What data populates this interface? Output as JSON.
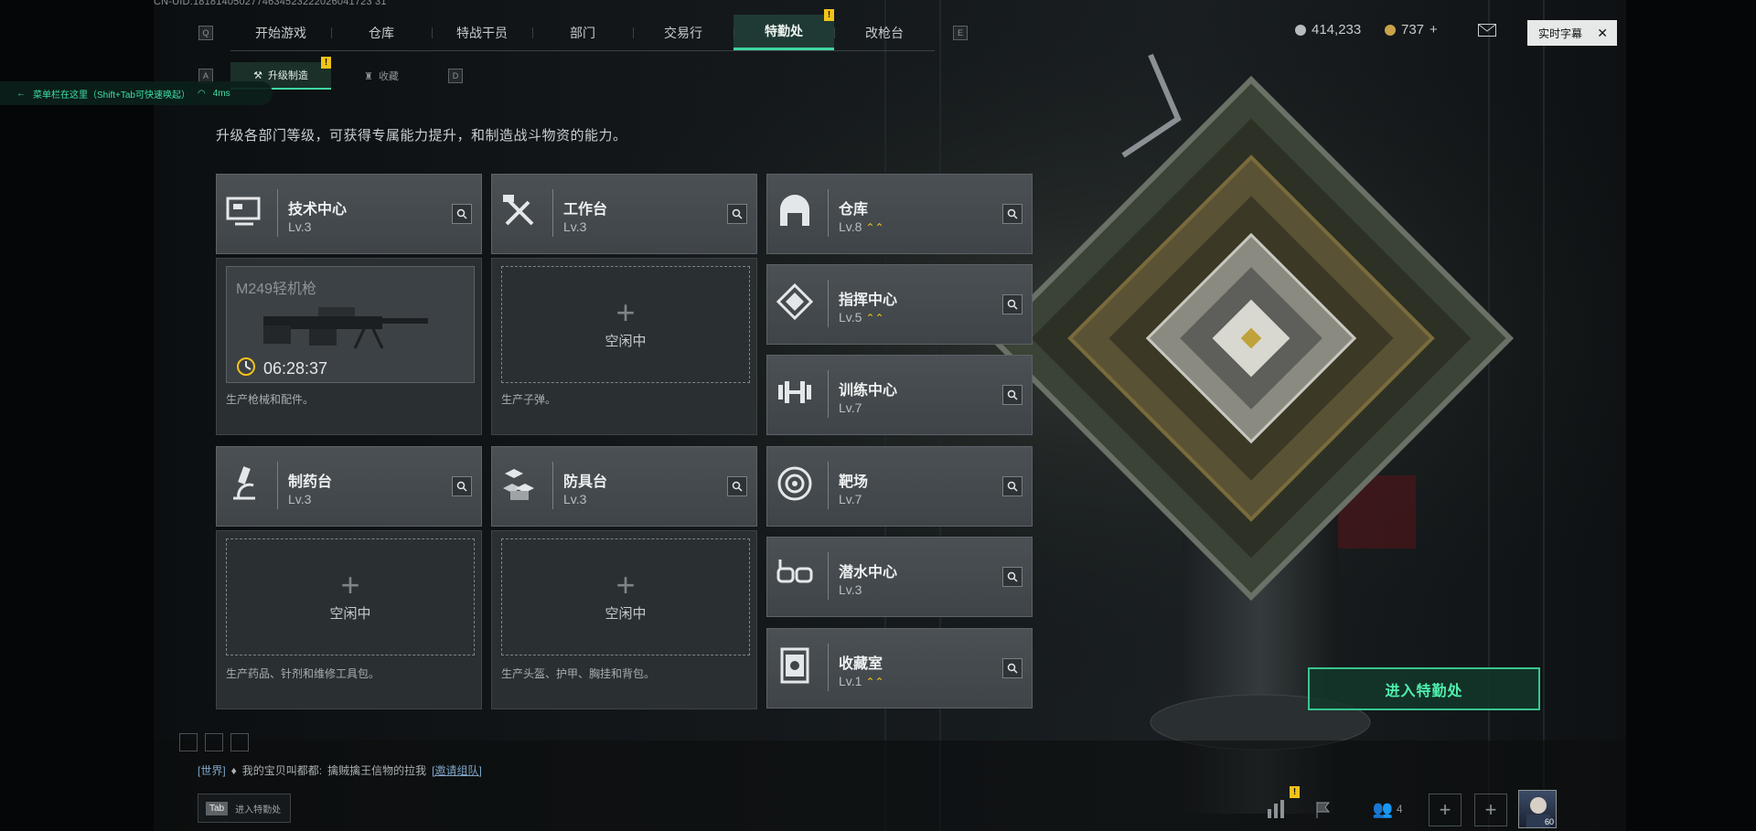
{
  "uid_text": "CN-UID:1818140502774634523222026041723 31",
  "top_nav": {
    "key_left": "Q",
    "key_right": "E",
    "tabs": [
      {
        "label": "开始游戏"
      },
      {
        "label": "仓库"
      },
      {
        "label": "特战干员"
      },
      {
        "label": "部门"
      },
      {
        "label": "交易行"
      },
      {
        "label": "特勤处",
        "active": true,
        "alert": "!"
      },
      {
        "label": "改枪台"
      }
    ]
  },
  "currency": {
    "silver": "414,233",
    "gold": "737",
    "gold_add": "+"
  },
  "caption_button": {
    "label": "实时字幕",
    "close": "✕"
  },
  "sub_nav": {
    "key_left": "A",
    "key_right": "D",
    "tabs": [
      {
        "label": "升级制造",
        "active": true,
        "alert": "!"
      },
      {
        "label": "收藏"
      }
    ]
  },
  "overlay_hint": {
    "text": "菜单栏在这里（Shift+Tab可快速唤起）",
    "ping": "4ms"
  },
  "description": "升级各部门等级，可获得专属能力提升，和制造战斗物资的能力。",
  "departments": {
    "tech_center": {
      "name": "技术中心",
      "level": "Lv.3",
      "icon": "monitor-icon"
    },
    "workbench": {
      "name": "工作台",
      "level": "Lv.3",
      "icon": "tools-icon"
    },
    "warehouse": {
      "name": "仓库",
      "level": "Lv.8",
      "upgrade": "⌃⌃",
      "icon": "warehouse-icon"
    },
    "command_center": {
      "name": "指挥中心",
      "level": "Lv.5",
      "upgrade": "⌃⌃",
      "icon": "chip-icon"
    },
    "training_center": {
      "name": "训练中心",
      "level": "Lv.7",
      "icon": "dumbbell-icon"
    },
    "pharmacy": {
      "name": "制药台",
      "level": "Lv.3",
      "icon": "microscope-icon"
    },
    "armor_bench": {
      "name": "防具台",
      "level": "Lv.3",
      "icon": "cubes-icon"
    },
    "shooting_range": {
      "name": "靶场",
      "level": "Lv.7",
      "icon": "target-icon"
    },
    "diving_center": {
      "name": "潜水中心",
      "level": "Lv.3",
      "icon": "goggles-icon"
    },
    "collection_room": {
      "name": "收藏室",
      "level": "Lv.1",
      "upgrade": "⌃⌃",
      "icon": "vault-icon"
    }
  },
  "production": {
    "tech_center": {
      "item": "M249轻机枪",
      "timer": "06:28:37",
      "note": "生产枪械和配件。"
    },
    "workbench": {
      "idle": "空闲中",
      "note": "生产子弹。"
    },
    "pharmacy": {
      "idle": "空闲中",
      "note": "生产药品、针剂和维修工具包。"
    },
    "armor_bench": {
      "idle": "空闲中",
      "note": "生产头盔、护甲、胸挂和背包。"
    }
  },
  "enter_button": "进入特勤处",
  "chat": {
    "channel": "[世界]",
    "user": "我的宝贝叫都都:",
    "message": "擒贼擒王信物的拉我",
    "invite": "[邀请组队]"
  },
  "tab_hint": {
    "key": "Tab",
    "label": "进入特勤处"
  },
  "bottom_right": {
    "squad_count": "4",
    "alert": "!",
    "avatar_level": "60"
  },
  "colors": {
    "accent": "#3fd7a1",
    "alert": "#f2c317",
    "card": "#464c50"
  }
}
